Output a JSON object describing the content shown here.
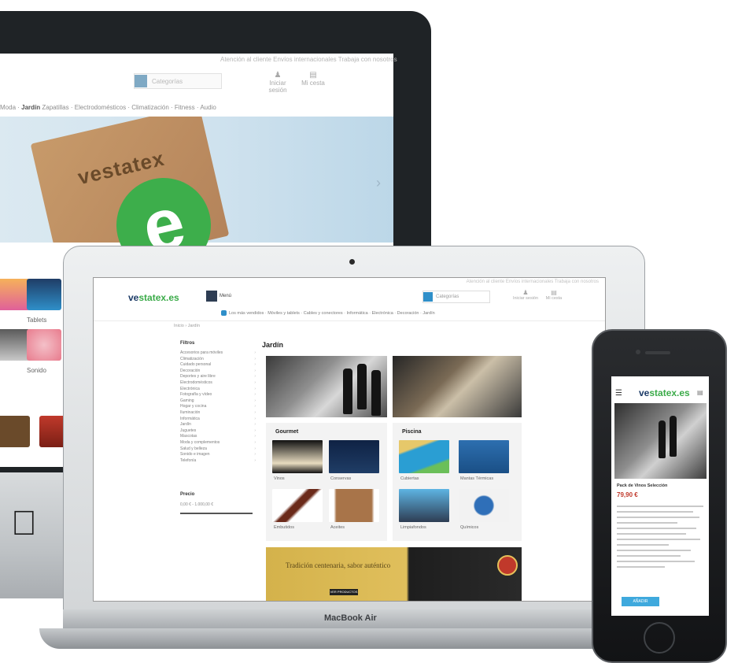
{
  "imac": {
    "topbar": "Atención al cliente    Envíos internacionales    Trabaja con nosotros",
    "search_placeholder": "Categorías",
    "account_label": "Iniciar sesión",
    "cart_label": "Mi cesta",
    "nav_prefix": "Moda ·",
    "nav_bold": "Jardín",
    "nav_rest": "Zapatillas ·  Electrodomésticos ·  Climatización ·  Fitness ·  Audio",
    "hero_brand": "vestatex",
    "hero_letter": "e",
    "products": [
      {
        "label": "Tablets"
      },
      {
        "label": "Sonido"
      }
    ],
    "apple": ""
  },
  "macbook": {
    "label": "MacBook Air",
    "site": {
      "logo_a": "ve",
      "logo_b": "statex.es",
      "menu_label": "Menú",
      "topline": "Atención al cliente   Envíos internacionales   Trabaja con nosotros",
      "search_placeholder": "Categorías",
      "account_label": "Iniciar sesión",
      "cart_label": "Mi cesta",
      "nav": "Los más vendidos · Móviles y tablets · Cables y conectores · Informática · Electrónica · Decoración · Jardín",
      "breadcrumb": "Inicio  ›  Jardín",
      "sidebar_title": "Filtros",
      "sidebar_items": [
        "Accesorios para móviles",
        "Climatización",
        "Cuidado personal",
        "Decoración",
        "Deportes y aire libre",
        "Electrodomésticos",
        "Electrónica",
        "Fotografía y vídeo",
        "Gaming",
        "Hogar y cocina",
        "Iluminación",
        "Informática",
        "Jardín",
        "Juguetes",
        "Mascotas",
        "Moda y complementos",
        "Salud y belleza",
        "Sonido e imagen",
        "Telefonía"
      ],
      "price_title": "Precio",
      "price_value": "0,00 € - 1.000,00 €",
      "category_title": "Jardín",
      "gourmet_title": "Gourmet",
      "gourmet_items": [
        "Vinos",
        "Conservas",
        "Embutidos",
        "Aceites"
      ],
      "piscina_title": "Piscina",
      "piscina_items": [
        "Cubiertas",
        "Mantas Térmicas",
        "Limpiafondos",
        "Químicos"
      ],
      "promo_text": "Tradición centenaria, sabor auténtico",
      "promo_button": "VER PRODUCTOS"
    }
  },
  "iphone": {
    "logo_a": "ve",
    "logo_b": "statex.es",
    "product_title": "Pack de Vinos Selección",
    "price": "79,90 €",
    "cta": "AÑADIR"
  }
}
